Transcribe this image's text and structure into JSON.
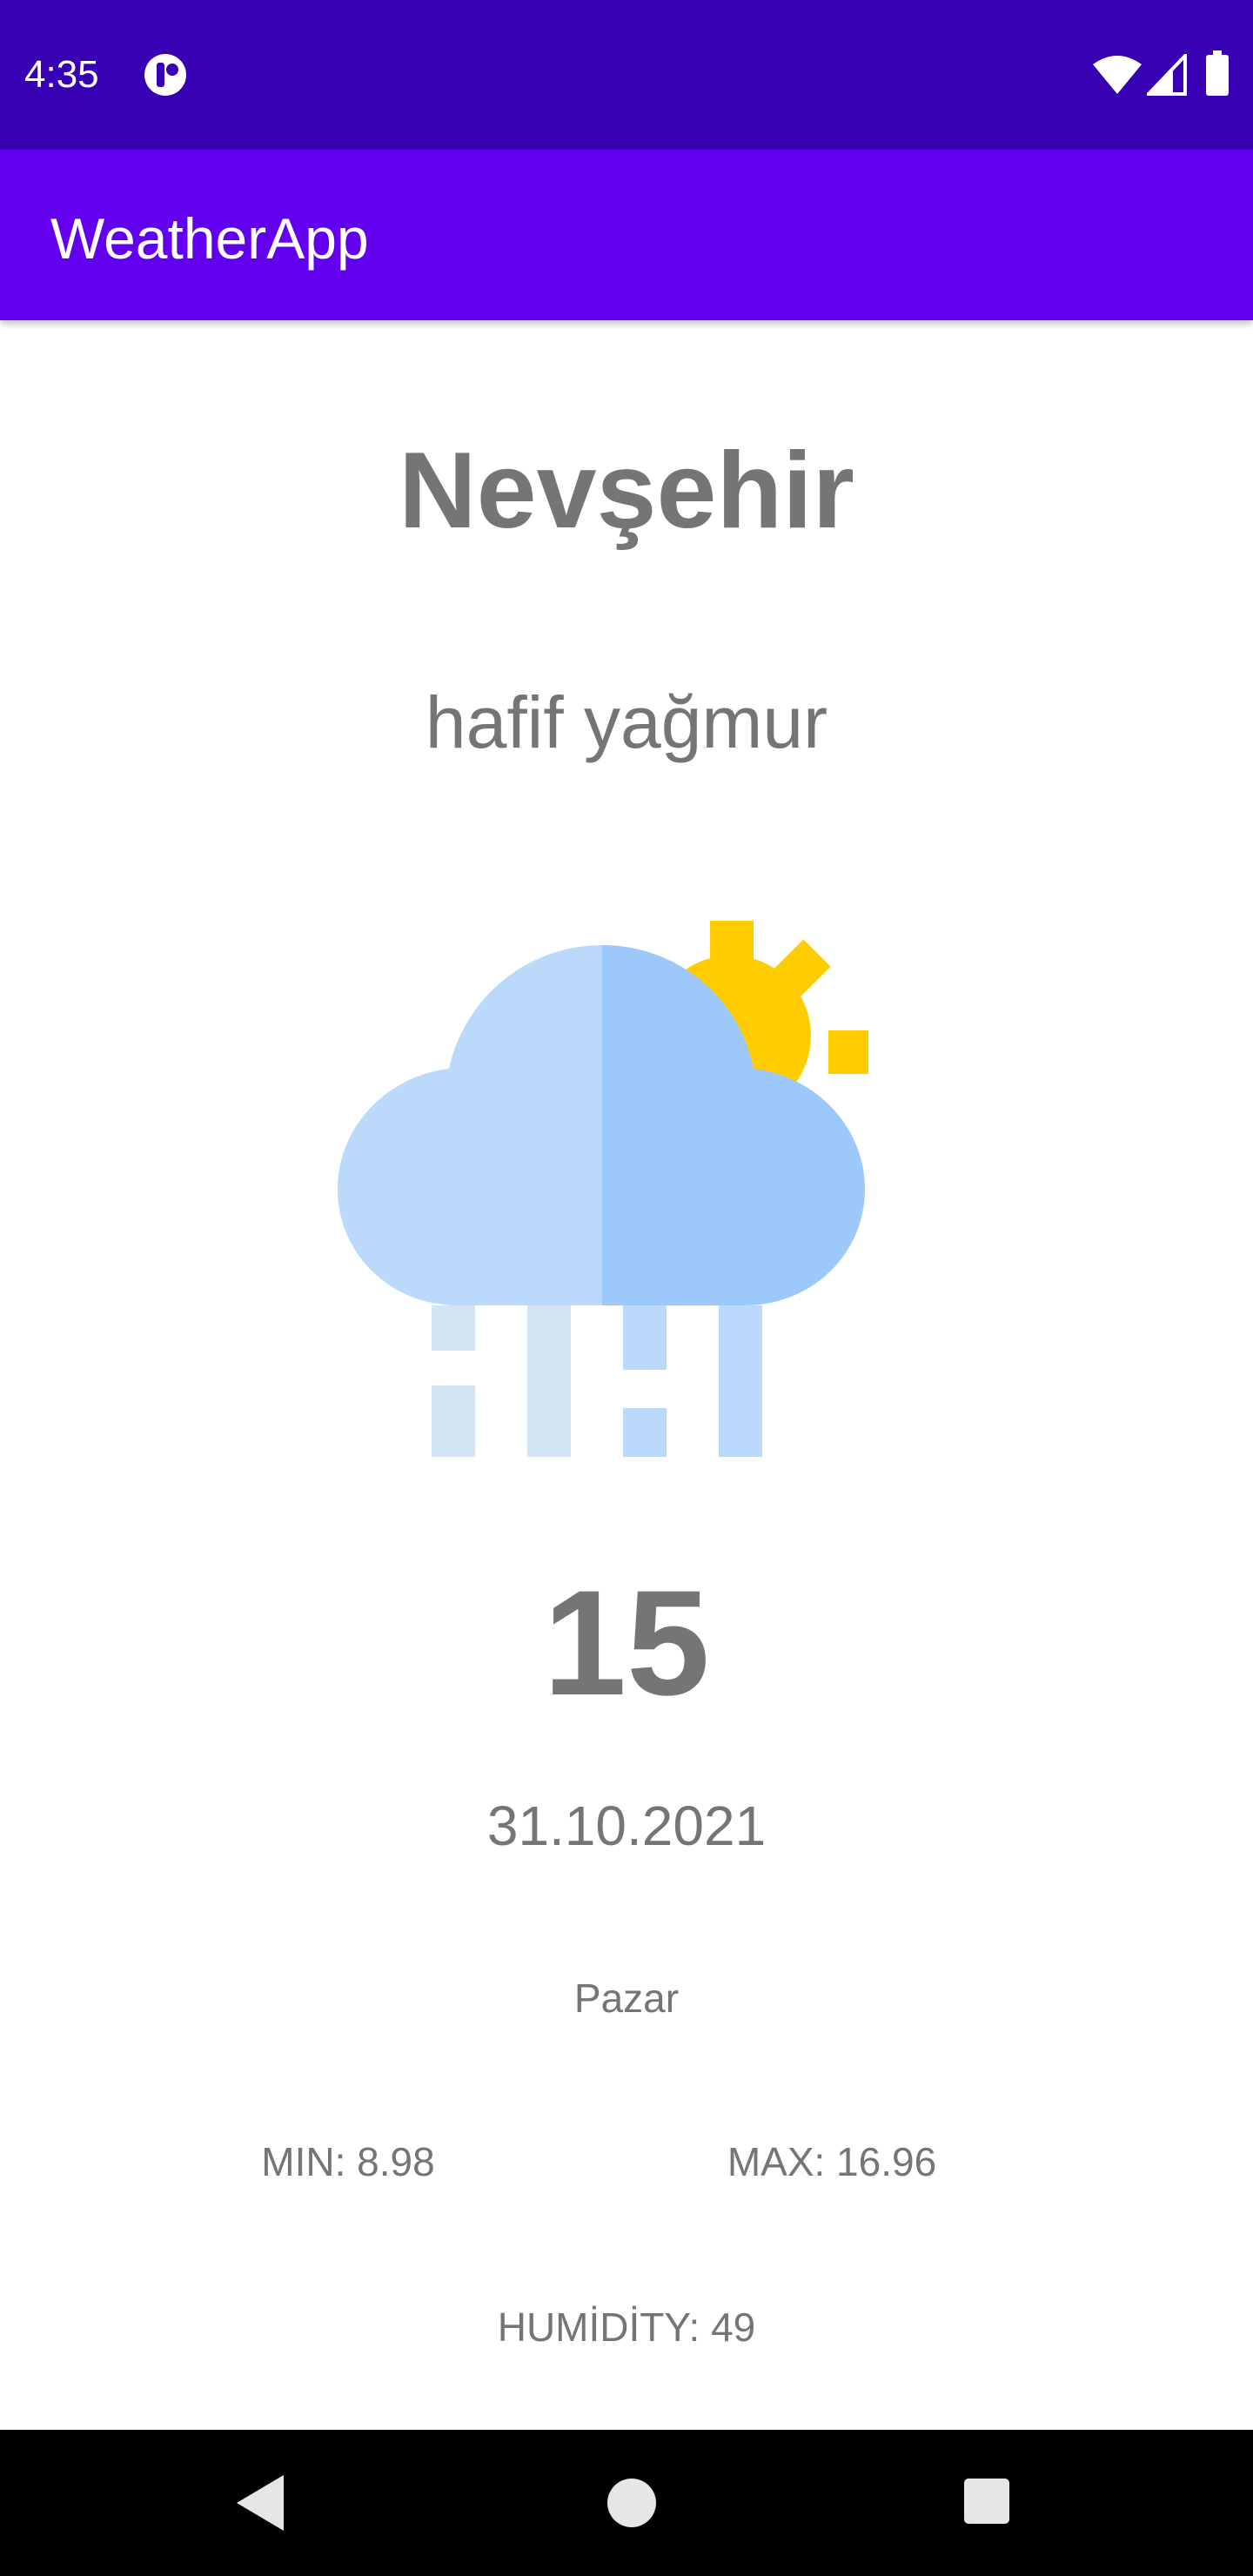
{
  "status_bar": {
    "time": "4:35",
    "icons": [
      "app-notification-icon",
      "wifi-icon",
      "signal-icon",
      "battery-icon"
    ],
    "background": "#3700B3"
  },
  "app_bar": {
    "title": "WeatherApp",
    "background": "#6200EE"
  },
  "weather": {
    "city": "Nevşehir",
    "description": "hafif yağmur",
    "icon": "cloud-sun-rain-icon",
    "temperature": "15",
    "date": "31.10.2021",
    "day": "Pazar",
    "min": "MIN: 8.98",
    "max": "MAX: 16.96",
    "humidity": "HUMİDİTY: 49"
  },
  "nav_bar": {
    "icons": [
      "back-icon",
      "home-icon",
      "recent-apps-icon"
    ]
  },
  "colors": {
    "text_gray": "#757575",
    "sun": "#FFCC00",
    "cloud_light": "#BBDAFB",
    "cloud_dark": "#9CC8FA",
    "rain_light": "#D3E5F5"
  }
}
